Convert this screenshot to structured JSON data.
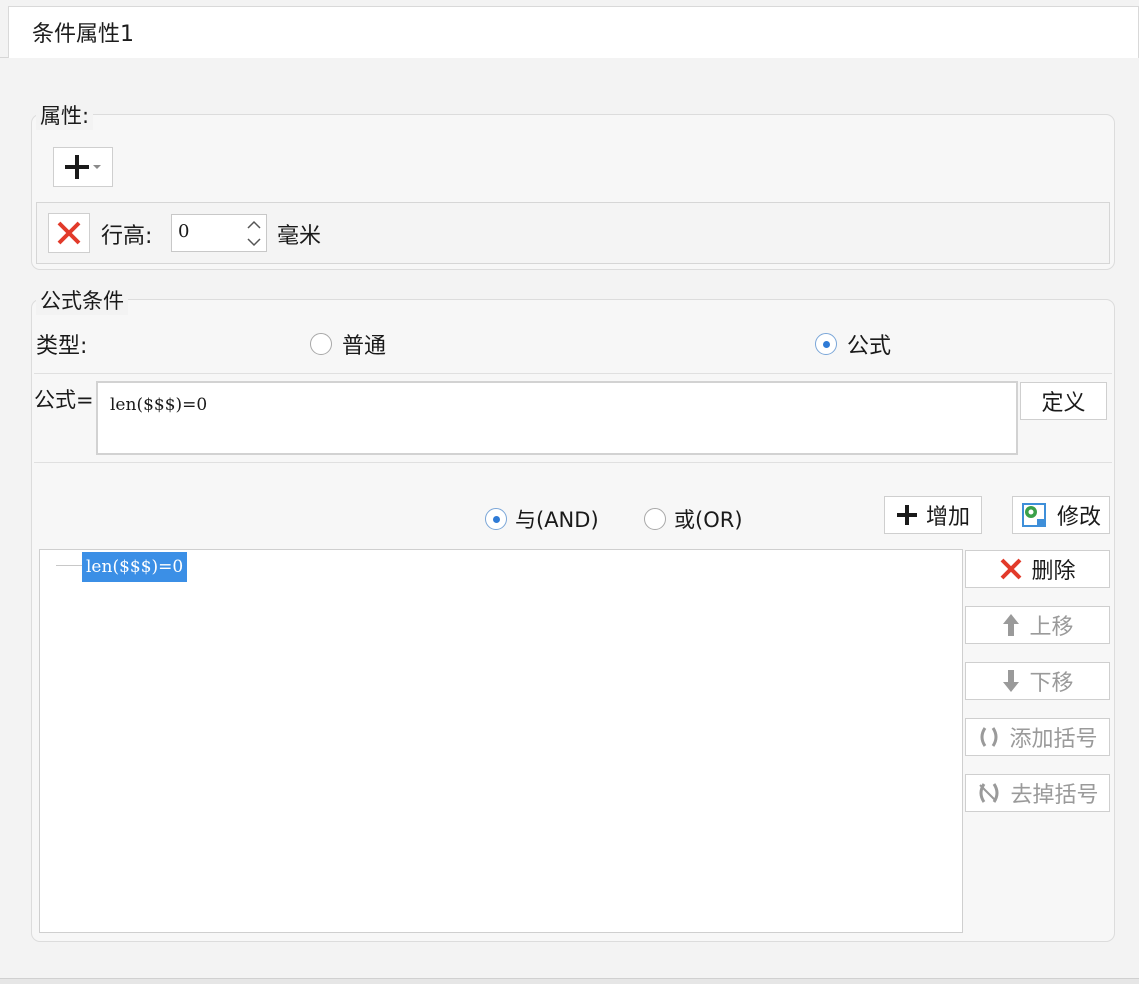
{
  "window": {
    "title": "条件属性1"
  },
  "attributes": {
    "label": "属性:",
    "add_button_icon": "plus-icon",
    "row_height": {
      "label": "行高:",
      "value": "0",
      "unit": "毫米"
    }
  },
  "formula_condition": {
    "label": "公式条件",
    "type_label": "类型:",
    "type_options": [
      {
        "label": "普通",
        "checked": false
      },
      {
        "label": "公式",
        "checked": true
      }
    ],
    "formula_label": "公式=",
    "formula_value": "len($$$)=0",
    "define_button": "定义",
    "logic_options": [
      {
        "label": "与(AND)",
        "checked": true
      },
      {
        "label": "或(OR)",
        "checked": false
      }
    ],
    "add_button": "增加",
    "modify_button": "修改",
    "delete_button": "删除",
    "move_up_button": "上移",
    "move_down_button": "下移",
    "add_bracket_button": "添加括号",
    "remove_bracket_button": "去掉括号",
    "condition_tree": [
      "len($$$)=0"
    ]
  },
  "colors": {
    "accent": "#2f7bd6",
    "selection": "#3b8fe6",
    "delete_red": "#e23a2a"
  }
}
